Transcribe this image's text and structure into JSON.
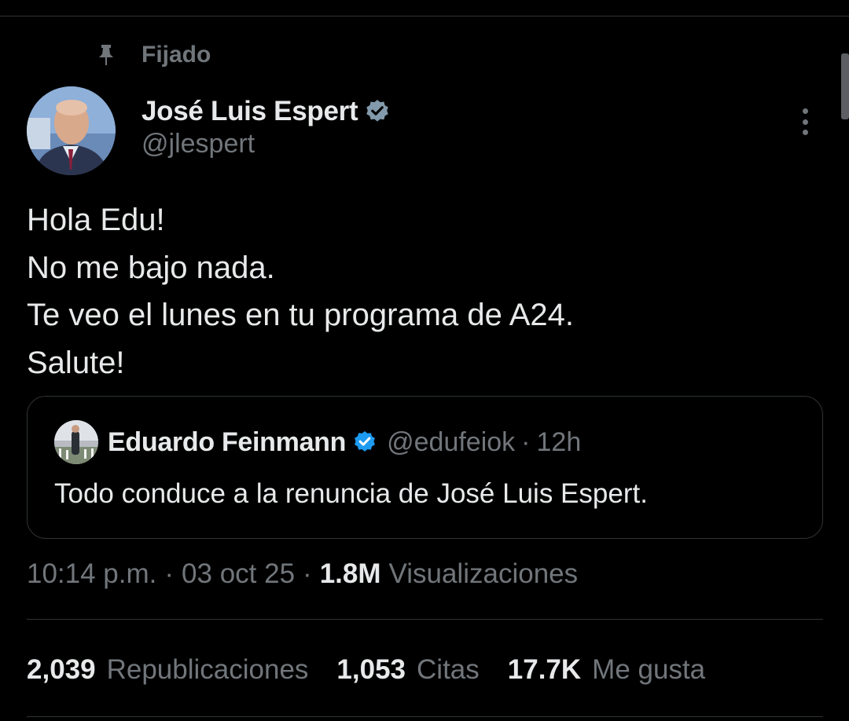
{
  "pinned": {
    "label": "Fijado"
  },
  "author": {
    "name": "José Luis Espert",
    "handle": "@jlespert",
    "verified": true
  },
  "tweet": {
    "lines": [
      "Hola Edu!",
      "No me bajo nada.",
      "Te veo el lunes en tu programa de A24.",
      "Salute!"
    ]
  },
  "quote": {
    "name": "Eduardo Feinmann",
    "handle": "@edufeiok",
    "separator": "·",
    "time": "12h",
    "text": "Todo conduce a la renuncia de José Luis Espert.",
    "verified": true
  },
  "meta": {
    "time": "10:14 p.m.",
    "separator": "·",
    "date": "03 oct 25",
    "views_count": "1.8M",
    "views_label": "Visualizaciones"
  },
  "stats": [
    {
      "value": "2,039",
      "label": "Republicaciones"
    },
    {
      "value": "1,053",
      "label": "Citas"
    },
    {
      "value": "17.7K",
      "label": "Me gusta"
    }
  ],
  "colors": {
    "background": "#000000",
    "text_primary": "#e7e9ea",
    "text_secondary": "#71767b",
    "divider": "#2f3336",
    "verified_blue": "#1d9bf0",
    "verified_gray": "#829aab"
  },
  "icons": {
    "pin": "pin-icon",
    "verified": "verified-badge-icon",
    "more": "more-options-icon"
  }
}
